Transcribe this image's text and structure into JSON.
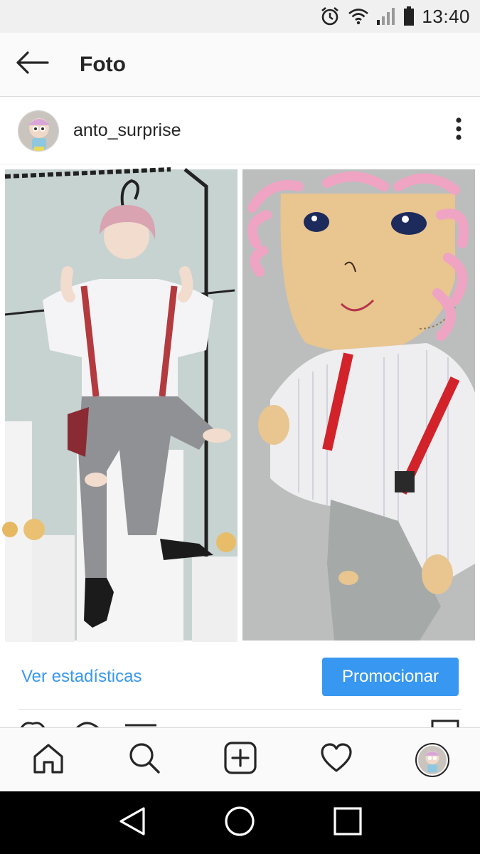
{
  "status_bar": {
    "time": "13:40",
    "icons": [
      "alarm-icon",
      "wifi-icon",
      "signal-icon",
      "battery-icon"
    ]
  },
  "app_bar": {
    "back_icon": "arrow-left-icon",
    "title": "Foto"
  },
  "post": {
    "username": "anto_surprise",
    "avatar_icon": "doll-avatar",
    "more_icon": "more-vertical-icon",
    "image": {
      "left_panel": "photo-person-pink-hair",
      "right_panel": "photo-felt-doll-pink-hair"
    }
  },
  "actions": {
    "stats_link": "Ver estadísticas",
    "promote_button": "Promocionar"
  },
  "bottom_nav": {
    "items": [
      "home-icon",
      "search-icon",
      "add-post-icon",
      "heart-icon",
      "profile-avatar"
    ]
  },
  "android_nav": {
    "items": [
      "back-triangle-icon",
      "home-circle-icon",
      "recents-square-icon"
    ]
  },
  "colors": {
    "accent": "#3897f0",
    "text": "#262626",
    "bar_bg": "#fafafa",
    "status_bg": "#f0f0f0"
  }
}
